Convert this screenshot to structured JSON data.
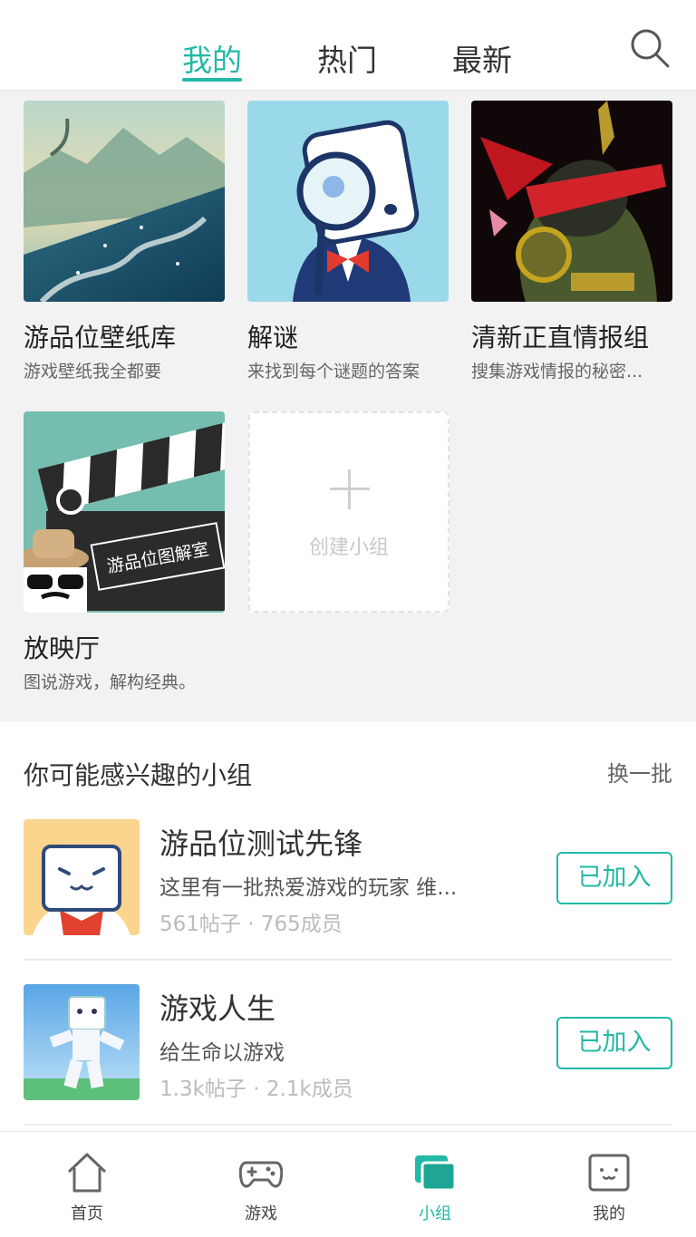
{
  "header": {
    "tabs": [
      {
        "label": "我的",
        "active": true
      },
      {
        "label": "热门",
        "active": false
      },
      {
        "label": "最新",
        "active": false
      }
    ],
    "search_icon": "search-icon"
  },
  "my_groups": [
    {
      "name": "游品位壁纸库",
      "desc": "游戏壁纸我全都要"
    },
    {
      "name": "解谜",
      "desc": "来找到每个谜题的答案"
    },
    {
      "name": "清新正直情报组",
      "desc": "搜集游戏情报的秘密..."
    },
    {
      "name": "放映厅",
      "desc": "图说游戏，解构经典。",
      "clapper_text": "游品位图解室"
    }
  ],
  "create_group": {
    "label": "创建小组"
  },
  "recommend": {
    "title": "你可能感兴趣的小组",
    "refresh_label": "换一批",
    "items": [
      {
        "name": "游品位测试先锋",
        "desc": "这里有一批热爱游戏的玩家 维...",
        "stats": "561帖子 · 765成员",
        "button": "已加入"
      },
      {
        "name": "游戏人生",
        "desc": "给生命以游戏",
        "stats": "1.3k帖子 · 2.1k成员",
        "button": "已加入"
      }
    ]
  },
  "bottom_nav": [
    {
      "label": "首页",
      "icon": "home-icon",
      "active": false
    },
    {
      "label": "游戏",
      "icon": "gamepad-icon",
      "active": false
    },
    {
      "label": "小组",
      "icon": "group-icon",
      "active": true
    },
    {
      "label": "我的",
      "icon": "profile-icon",
      "active": false
    }
  ],
  "colors": {
    "accent": "#22b9a6",
    "page_bg": "#f2f2f2",
    "text": "#333333"
  }
}
